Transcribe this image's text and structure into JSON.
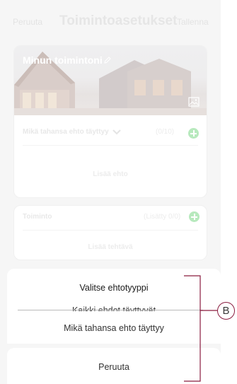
{
  "header": {
    "cancel": "Peruuta",
    "title": "Toimintoasetukset",
    "save": "Tallenna"
  },
  "card": {
    "name": "Minun toimintoni",
    "condition_label": "Mikä tahansa ehto täyttyy",
    "condition_count": "(0/10)",
    "add_condition": "Lisää ehto"
  },
  "action": {
    "label": "Toiminto",
    "count": "(Lisätty 0/0)",
    "add_task": "Lisää tehtävä"
  },
  "sheet": {
    "title": "Valitse ehtotyyppi",
    "option_all": "Kaikki ehdot täyttyvät",
    "option_any": "Mikä tahansa ehto täyttyy",
    "cancel": "Peruuta"
  },
  "callout": {
    "label": "B"
  },
  "colors": {
    "accent_green": "#3dc45a",
    "callout_line": "#8a1c3f"
  },
  "icons": [
    "pencil-icon",
    "image-icon",
    "chevron-down-icon",
    "plus-circle-icon"
  ]
}
